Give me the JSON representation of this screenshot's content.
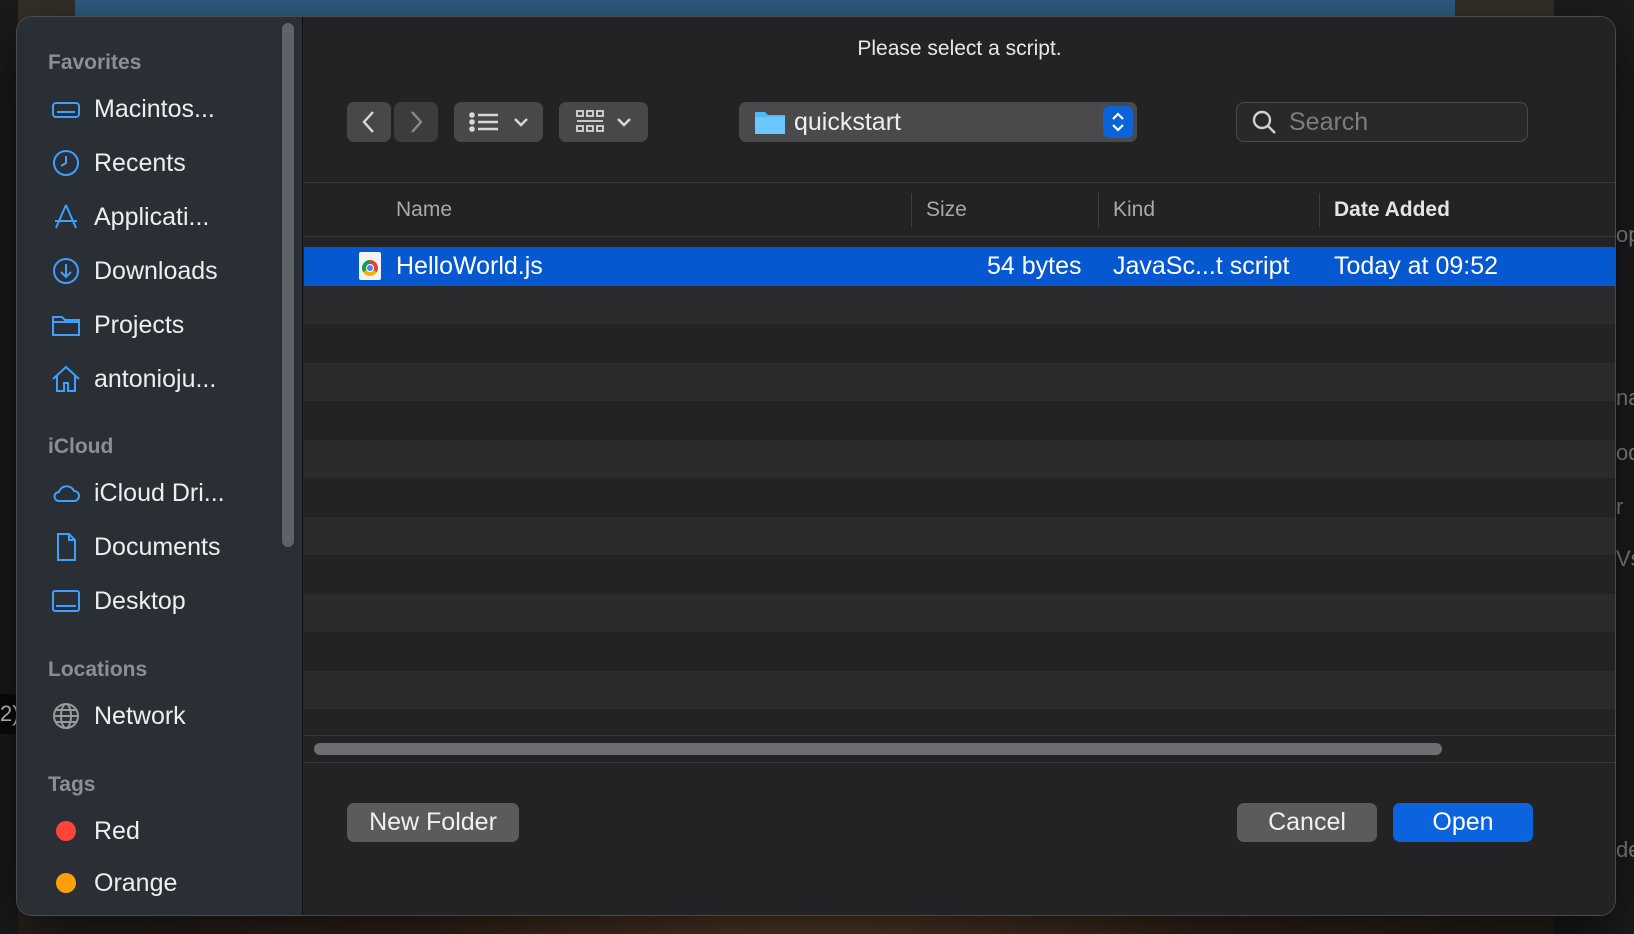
{
  "dialog": {
    "title": "Please select a script."
  },
  "sidebar": {
    "sections": [
      {
        "label": "Favorites"
      },
      {
        "label": "iCloud"
      },
      {
        "label": "Locations"
      },
      {
        "label": "Tags"
      }
    ],
    "favorites": [
      {
        "label": "Macintos...",
        "icon": "hard-drive-icon"
      },
      {
        "label": "Recents",
        "icon": "clock-icon"
      },
      {
        "label": "Applicati...",
        "icon": "applications-icon"
      },
      {
        "label": "Downloads",
        "icon": "download-icon"
      },
      {
        "label": "Projects",
        "icon": "folder-icon"
      },
      {
        "label": "antonioju...",
        "icon": "home-icon"
      }
    ],
    "icloud": [
      {
        "label": "iCloud Dri...",
        "icon": "cloud-icon"
      },
      {
        "label": "Documents",
        "icon": "document-icon"
      },
      {
        "label": "Desktop",
        "icon": "desktop-icon"
      }
    ],
    "locations": [
      {
        "label": "Network",
        "icon": "globe-icon"
      }
    ],
    "tags": [
      {
        "label": "Red",
        "color": "#ff453a"
      },
      {
        "label": "Orange",
        "color": "#ff9f0a"
      }
    ]
  },
  "toolbar": {
    "current_folder": "quickstart",
    "search_placeholder": "Search"
  },
  "file_list": {
    "columns": [
      {
        "label": "Name"
      },
      {
        "label": "Size"
      },
      {
        "label": "Kind"
      },
      {
        "label": "Date Added",
        "sorted": true
      }
    ],
    "rows": [
      {
        "name": "HelloWorld.js",
        "size": "54 bytes",
        "kind": "JavaSc...t script",
        "date_added": "Today at 09:52",
        "selected": true
      }
    ]
  },
  "buttons": {
    "new_folder": "New Folder",
    "cancel": "Cancel",
    "open": "Open"
  },
  "background_fragments": [
    "2)",
    "op",
    "na",
    "od",
    "r",
    "Vs",
    "de"
  ],
  "colors": {
    "accent": "#0658d1",
    "sidebar_icon": "#3da0ff"
  }
}
